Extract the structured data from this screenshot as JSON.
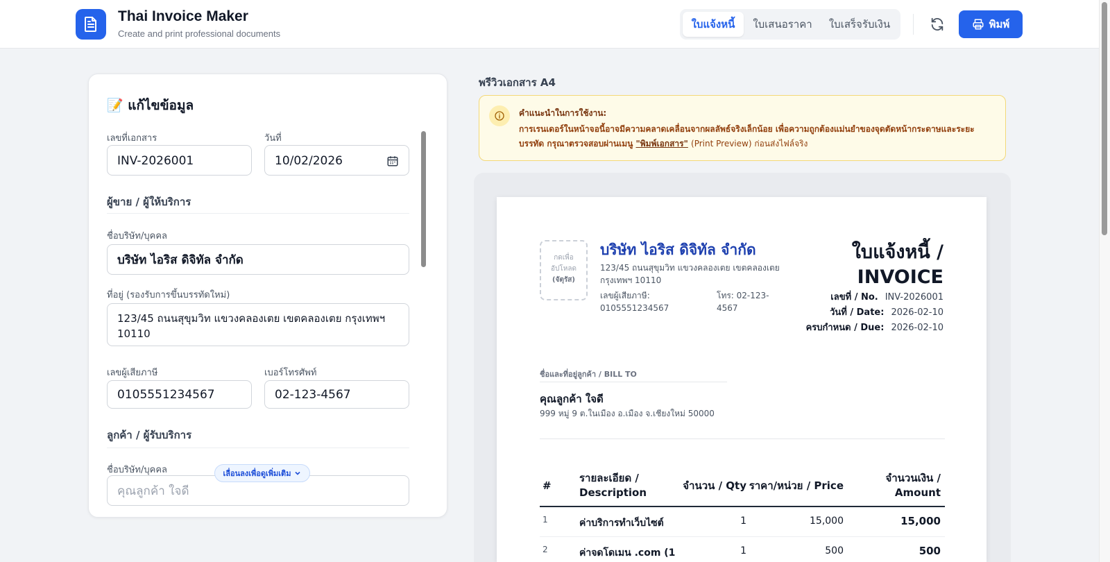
{
  "app": {
    "title": "Thai Invoice Maker",
    "subtitle": "Create and print professional documents",
    "accent": "#2563eb"
  },
  "tabs": [
    {
      "label": "ใบแจ้งหนี้",
      "active": true
    },
    {
      "label": "ใบเสนอราคา",
      "active": false
    },
    {
      "label": "ใบเสร็จรับเงิน",
      "active": false
    }
  ],
  "toolbar": {
    "refresh_icon": "refresh-icon",
    "print_label": "พิมพ์"
  },
  "editor": {
    "title": "📝 แก้ไขข้อมูล",
    "doc_no_label": "เลขที่เอกสาร",
    "doc_no": "INV-2026001",
    "date_label": "วันที่",
    "date": "10/02/2026",
    "seller_section": "ผู้ขาย / ผู้ให้บริการ",
    "seller_name_label": "ชื่อบริษัท/บุคคล",
    "seller_name": "บริษัท ไอริส ดิจิทัล จำกัด",
    "seller_addr_label": "ที่อยู่ (รองรับการขึ้นบรรทัดใหม่)",
    "seller_addr": "123/45 ถนนสุขุมวิท แขวงคลองเตย เขตคลองเตย กรุงเทพฯ 10110",
    "tax_label": "เลขผู้เสียภาษี",
    "tax": "0105551234567",
    "phone_label": "เบอร์โทรศัพท์",
    "phone": "02-123-4567",
    "client_section": "ลูกค้า / ผู้รับบริการ",
    "client_name_label": "ชื่อบริษัท/บุคคล",
    "client_name": "คุณลูกค้า ใจดี",
    "scroll_more": "เลื่อนลงเพื่อดูเพิ่มเติม"
  },
  "preview": {
    "label": "พรีวิวเอกสาร A4",
    "notice_title": "คำแนะนำในการใช้งาน:",
    "notice_text": "การเรนเดอร์ในหน้าจอนี้อาจมีความคลาดเคลื่อนจากผลลัพธ์จริงเล็กน้อย เพื่อความถูกต้องแม่นยำของจุดตัดหน้ากระดาษและระยะบรรทัด กรุณาตรวจสอบผ่านเมนู",
    "notice_link": "\"พิมพ์เอกสาร\"",
    "notice_tail": "(Print Preview) ก่อนส่งไฟล์จริง",
    "upload_line1": "กดเพื่อ",
    "upload_line2": "อัปโหลด",
    "upload_line3": "(จัตุรัส)",
    "company": "บริษัท ไอริส ดิจิทัล จำกัด",
    "address": "123/45 ถนนสุขุมวิท แขวงคลองเตย เขตคลองเตย กรุงเทพฯ 10110",
    "tax_text": "เลขผู้เสียภาษี: 0105551234567",
    "phone_text": "โทร: 02-123-4567",
    "doc_title_th": "ใบแจ้งหนี้ /",
    "doc_title_en": "INVOICE",
    "no_label": "เลขที่ / No.",
    "no_value": "INV-2026001",
    "date_label": "วันที่ / Date:",
    "date_value": "2026-02-10",
    "due_label": "ครบกำหนด / Due:",
    "due_value": "2026-02-10",
    "billto_label": "ชื่อและที่อยู่ลูกค้า / BILL TO",
    "client": "คุณลูกค้า ใจดี",
    "client_addr": "999 หมู่ 9 ต.ในเมือง อ.เมือง จ.เชียงใหม่ 50000",
    "col_no": "#",
    "col_desc_1": "รายละเอียด /",
    "col_desc_2": "Description",
    "col_qty": "จำนวน / Qty",
    "col_price": "ราคา/หน่วย / Price",
    "col_amount_1": "จำนวนเงิน /",
    "col_amount_2": "Amount",
    "items": [
      {
        "no": "1",
        "desc": "ค่าบริการทำเว็บไซต์",
        "qty": "1",
        "price": "15,000",
        "amount": "15,000"
      },
      {
        "no": "2",
        "desc": "ค่าจดโดเมน .com (1",
        "qty": "1",
        "price": "500",
        "amount": "500"
      }
    ]
  }
}
